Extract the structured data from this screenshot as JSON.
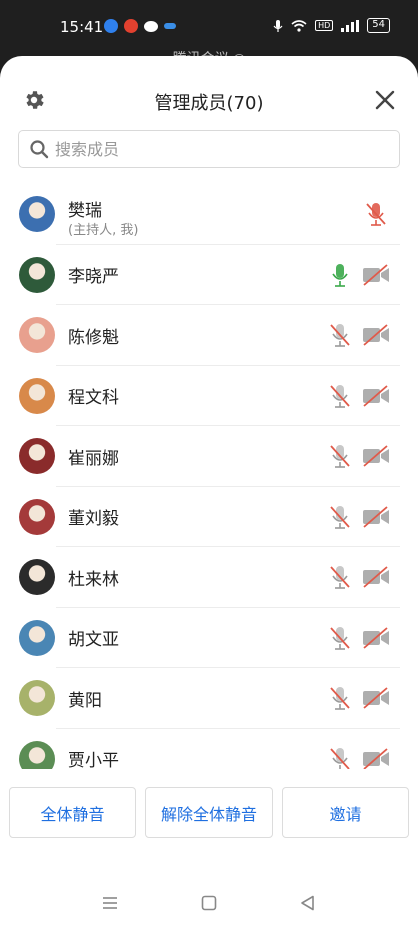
{
  "status_bar": {
    "time": "15:41",
    "network": "HD",
    "battery": "54"
  },
  "behind": {
    "title": "腾讯会议 ◎"
  },
  "header": {
    "title": "管理成员(70)",
    "settings_icon": "gear-icon",
    "close_icon": "close-icon"
  },
  "search": {
    "placeholder": "搜索成员",
    "icon": "search-icon"
  },
  "members": [
    {
      "name": "樊瑞",
      "sub": "(主持人, 我)",
      "mic": "muted-red",
      "camera": "none",
      "avatar_color": "#3c6fb0"
    },
    {
      "name": "李晓严",
      "sub": "",
      "mic": "on-green",
      "camera": "off",
      "avatar_color": "#2e5a3a"
    },
    {
      "name": "陈修魁",
      "sub": "",
      "mic": "muted",
      "camera": "off",
      "avatar_color": "#e8a08e"
    },
    {
      "name": "程文科",
      "sub": "",
      "mic": "muted",
      "camera": "off",
      "avatar_color": "#d8894a"
    },
    {
      "name": "崔丽娜",
      "sub": "",
      "mic": "muted",
      "camera": "off",
      "avatar_color": "#8a2b2b"
    },
    {
      "name": "董刘毅",
      "sub": "",
      "mic": "muted",
      "camera": "off",
      "avatar_color": "#a43a3a"
    },
    {
      "name": "杜来林",
      "sub": "",
      "mic": "muted",
      "camera": "off",
      "avatar_color": "#2b2b2b"
    },
    {
      "name": "胡文亚",
      "sub": "",
      "mic": "muted",
      "camera": "off",
      "avatar_color": "#4a86b4"
    },
    {
      "name": "黄阳",
      "sub": "",
      "mic": "muted",
      "camera": "off",
      "avatar_color": "#a7b26a"
    },
    {
      "name": "贾小平",
      "sub": "",
      "mic": "muted",
      "camera": "off",
      "avatar_color": "#5b8d54"
    }
  ],
  "actions": {
    "mute_all": "全体静音",
    "unmute_all": "解除全体静音",
    "invite": "邀请"
  },
  "colors": {
    "accent": "#1f6fe0",
    "muted_red": "#e05a4a",
    "mic_green": "#3aa84a",
    "icon_grey": "#9a9a9a"
  },
  "navbar": {
    "menu_icon": "menu-icon",
    "home_icon": "home-square-icon",
    "back_icon": "back-triangle-icon"
  }
}
